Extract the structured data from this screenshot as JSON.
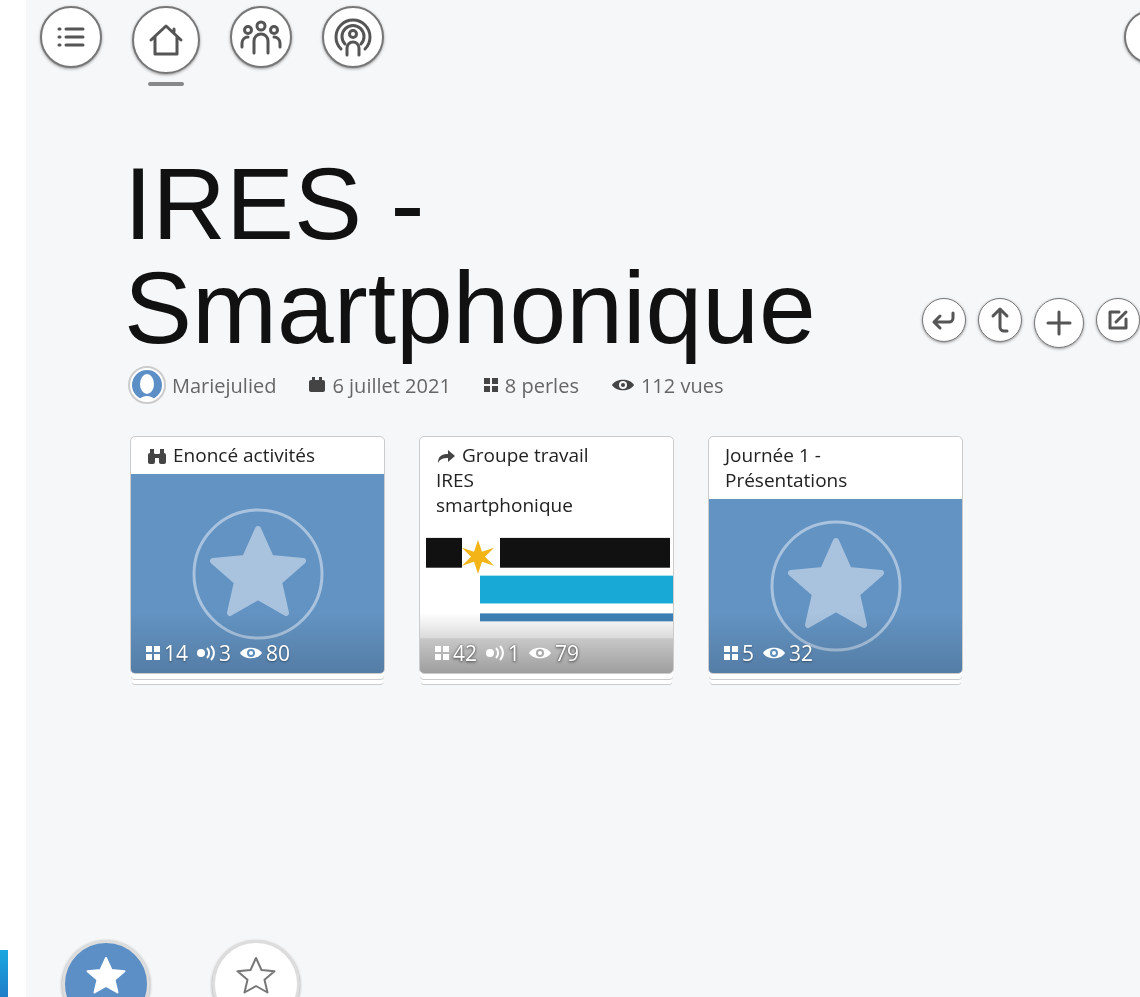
{
  "nav": [
    {
      "kind": "menu",
      "selected": false
    },
    {
      "kind": "home",
      "selected": true
    },
    {
      "kind": "group",
      "selected": false
    },
    {
      "kind": "broadcast",
      "selected": false
    }
  ],
  "title": "IRES - Smartphonique",
  "actions": [
    {
      "kind": "back"
    },
    {
      "kind": "up"
    },
    {
      "kind": "add"
    },
    {
      "kind": "edit"
    }
  ],
  "meta": {
    "author": "Mariejulied",
    "date": "6 juillet 2021",
    "pearls": "8 perles",
    "views": "112 vues"
  },
  "cards": [
    {
      "title": "Enoncé activités",
      "title_icon": {
        "kind": "binoculars"
      },
      "cover": {
        "kind": "star"
      },
      "stats": [
        {
          "kind": "pearls",
          "value": "14"
        },
        {
          "kind": "sound",
          "value": "3"
        },
        {
          "kind": "views",
          "value": "80"
        }
      ]
    },
    {
      "title": "Groupe travail IRES smartphonique",
      "title_icon": {
        "kind": "share"
      },
      "cover": {
        "kind": "picture"
      },
      "stats": [
        {
          "kind": "pearls",
          "value": "42"
        },
        {
          "kind": "sound",
          "value": "1"
        },
        {
          "kind": "views",
          "value": "79"
        }
      ]
    },
    {
      "title": "Journée 1 - Présentations",
      "cover": {
        "kind": "star"
      },
      "stats": [
        {
          "kind": "pearls",
          "value": "5"
        },
        {
          "kind": "views",
          "value": "32"
        }
      ]
    }
  ],
  "bottom": [
    {
      "kind": "star",
      "selected": true
    },
    {
      "kind": "star",
      "selected": false
    }
  ]
}
